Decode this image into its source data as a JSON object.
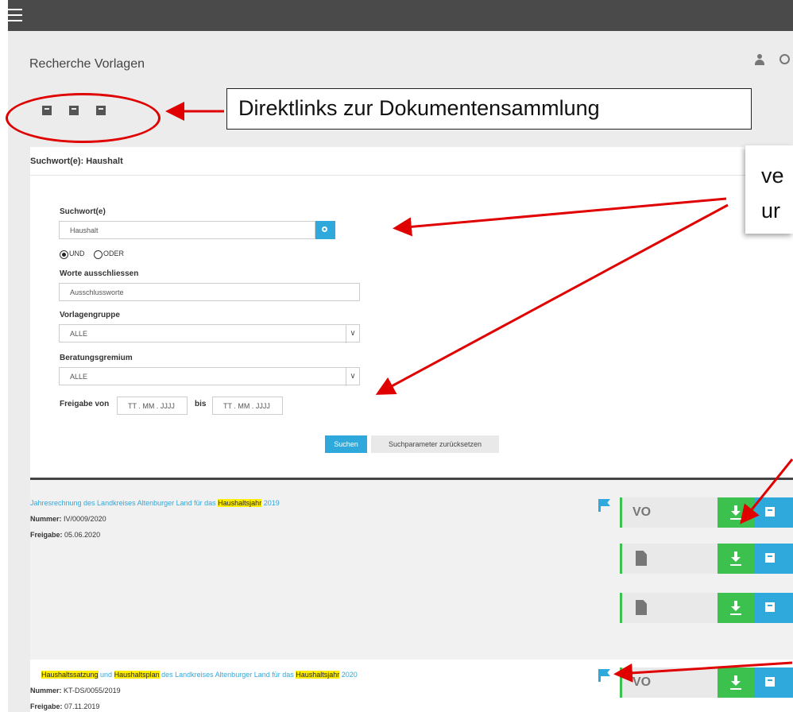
{
  "header": {
    "page_title": "Recherche Vorlagen"
  },
  "annotations": {
    "direct_links": "Direktlinks zur Dokumentensammlung",
    "right_line1": "ve",
    "right_line2": "ur"
  },
  "form": {
    "heading": "Suchwort(e): Haushalt",
    "keyword_label": "Suchwort(e)",
    "keyword_value": "Haushalt",
    "radio_and": "UND",
    "radio_or": "ODER",
    "exclude_label": "Worte ausschliessen",
    "exclude_placeholder": "Ausschlussworte",
    "group_label": "Vorlagengruppe",
    "group_value": "ALLE",
    "committee_label": "Beratungsgremium",
    "committee_value": "ALLE",
    "release_from_label": "Freigabe von",
    "release_from_placeholder": "TT . MM . JJJJ",
    "release_to_label": "bis",
    "release_to_placeholder": "TT . MM . JJJJ",
    "search_button": "Suchen",
    "reset_button": "Suchparameter zurücksetzen"
  },
  "results": [
    {
      "title_parts": [
        "Jahresrechnung des Landkreises Altenburger Land für das ",
        "Haushaltsjahr",
        " 2019"
      ],
      "number_label": "Nummer:",
      "number": "IV/0009/2020",
      "release_label": "Freigabe:",
      "release": "05.06.2020",
      "doc_type": "VO"
    },
    {
      "title_parts": [
        "Haushaltssatzung",
        " und ",
        "Haushaltsplan",
        " des Landkreises Altenburger Land für das ",
        "Haushaltsjahr",
        " 2020"
      ],
      "number_label": "Nummer:",
      "number": "KT-DS/0055/2019",
      "release_label": "Freigabe:",
      "release": "07.11.2019",
      "doc_type": "VO"
    }
  ],
  "colors": {
    "accent_blue": "#2fa8dc",
    "download_green": "#3cc14f",
    "annotation_red": "#e00000",
    "highlight_yellow": "#ffee00"
  }
}
